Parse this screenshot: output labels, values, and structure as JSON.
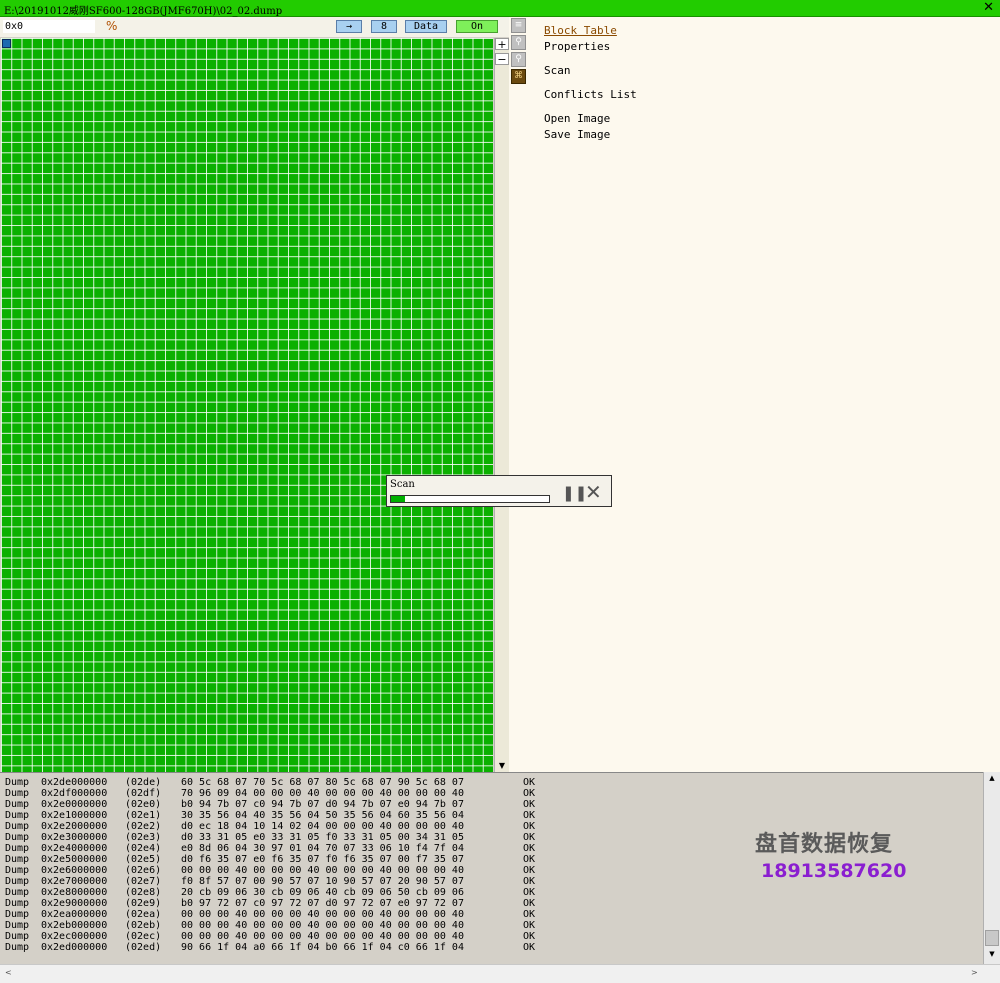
{
  "window": {
    "title": "E:\\20191012威刚SF600-128GB(JMF670H)\\02_02.dump",
    "close_glyph": "✕"
  },
  "toolbar": {
    "address_value": "0x0",
    "goto_label": "→",
    "page_size_label": "8",
    "mode_label": "Data",
    "toggle_label": "On"
  },
  "grid_scroll": {
    "up": "▲",
    "plus": "+",
    "minus": "−",
    "down": "▼"
  },
  "side_icons": [
    "list-icon",
    "magnify-plus-icon",
    "magnify-minus-icon",
    "map-icon"
  ],
  "side_menu": {
    "block_table": "Block Table",
    "properties": "Properties",
    "scan": "Scan",
    "conflicts_list": "Conflicts List",
    "open_image": "Open Image",
    "save_image": "Save Image"
  },
  "scan_dialog": {
    "title": "Scan",
    "progress": 0.09,
    "pause_glyph": "❚❚",
    "cancel_glyph": "✕"
  },
  "log": [
    {
      "op": "Dump",
      "addr": "0x2de000000",
      "block": "(02de)",
      "bytes": "60 5c 68 07 70 5c 68 07 80 5c 68 07 90 5c 68 07",
      "status": "OK"
    },
    {
      "op": "Dump",
      "addr": "0x2df000000",
      "block": "(02df)",
      "bytes": "70 96 09 04 00 00 00 40 00 00 00 40 00 00 00 40",
      "status": "OK"
    },
    {
      "op": "Dump",
      "addr": "0x2e0000000",
      "block": "(02e0)",
      "bytes": "b0 94 7b 07 c0 94 7b 07 d0 94 7b 07 e0 94 7b 07",
      "status": "OK"
    },
    {
      "op": "Dump",
      "addr": "0x2e1000000",
      "block": "(02e1)",
      "bytes": "30 35 56 04 40 35 56 04 50 35 56 04 60 35 56 04",
      "status": "OK"
    },
    {
      "op": "Dump",
      "addr": "0x2e2000000",
      "block": "(02e2)",
      "bytes": "d0 ec 18 04 10 14 02 04 00 00 00 40 00 00 00 40",
      "status": "OK"
    },
    {
      "op": "Dump",
      "addr": "0x2e3000000",
      "block": "(02e3)",
      "bytes": "d0 33 31 05 e0 33 31 05 f0 33 31 05 00 34 31 05",
      "status": "OK"
    },
    {
      "op": "Dump",
      "addr": "0x2e4000000",
      "block": "(02e4)",
      "bytes": "e0 8d 06 04 30 97 01 04 70 07 33 06 10 f4 7f 04",
      "status": "OK"
    },
    {
      "op": "Dump",
      "addr": "0x2e5000000",
      "block": "(02e5)",
      "bytes": "d0 f6 35 07 e0 f6 35 07 f0 f6 35 07 00 f7 35 07",
      "status": "OK"
    },
    {
      "op": "Dump",
      "addr": "0x2e6000000",
      "block": "(02e6)",
      "bytes": "00 00 00 40 00 00 00 40 00 00 00 40 00 00 00 40",
      "status": "OK"
    },
    {
      "op": "Dump",
      "addr": "0x2e7000000",
      "block": "(02e7)",
      "bytes": "f0 8f 57 07 00 90 57 07 10 90 57 07 20 90 57 07",
      "status": "OK"
    },
    {
      "op": "Dump",
      "addr": "0x2e8000000",
      "block": "(02e8)",
      "bytes": "20 cb 09 06 30 cb 09 06 40 cb 09 06 50 cb 09 06",
      "status": "OK"
    },
    {
      "op": "Dump",
      "addr": "0x2e9000000",
      "block": "(02e9)",
      "bytes": "b0 97 72 07 c0 97 72 07 d0 97 72 07 e0 97 72 07",
      "status": "OK"
    },
    {
      "op": "Dump",
      "addr": "0x2ea000000",
      "block": "(02ea)",
      "bytes": "00 00 00 40 00 00 00 40 00 00 00 40 00 00 00 40",
      "status": "OK"
    },
    {
      "op": "Dump",
      "addr": "0x2eb000000",
      "block": "(02eb)",
      "bytes": "00 00 00 40 00 00 00 40 00 00 00 40 00 00 00 40",
      "status": "OK"
    },
    {
      "op": "Dump",
      "addr": "0x2ec000000",
      "block": "(02ec)",
      "bytes": "00 00 00 40 00 00 00 40 00 00 00 40 00 00 00 40",
      "status": "OK"
    },
    {
      "op": "Dump",
      "addr": "0x2ed000000",
      "block": "(02ed)",
      "bytes": "90 66 1f 04 a0 66 1f 04 b0 66 1f 04 c0 66 1f 04",
      "status": "OK"
    }
  ],
  "scrollbars": {
    "up": "▲",
    "down": "▼",
    "left": "<",
    "right": ">"
  },
  "watermark": {
    "company": "盘首数据恢复",
    "phone": "18913587620"
  },
  "colors": {
    "title_bar": "#22cc00",
    "block_good": "#0bb000",
    "progress": "#00b000",
    "watermark_phone": "#8a1ed0"
  }
}
